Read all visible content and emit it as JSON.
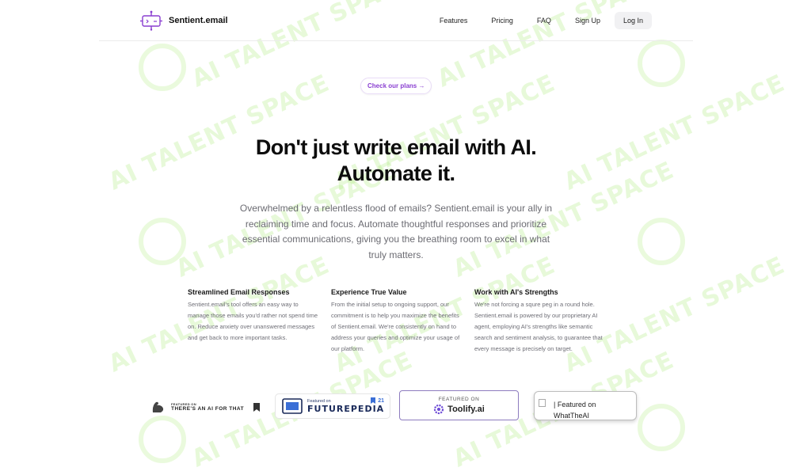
{
  "nav": {
    "brand": "Sentient.email",
    "links": [
      "Features",
      "Pricing",
      "FAQ",
      "Sign Up"
    ],
    "login": "Log In"
  },
  "hero": {
    "pill": "Check our plans →",
    "headline_line1": "Don't just write email with AI.",
    "headline_line2": "Automate it.",
    "subtext": "Overwhelmed by a relentless flood of emails? Sentient.email is your ally in reclaiming time and focus. Automate thoughtful responses and prioritize essential communications, giving you the breathing room to excel in what truly matters."
  },
  "features": [
    {
      "title": "Streamlined Email Responses",
      "body": "Sentient.email's tool offers an easy way to manage those emails you'd rather not spend time on. Reduce anxiety over unanswered messages and get back to more important tasks."
    },
    {
      "title": "Experience True Value",
      "body": "From the initial setup to ongoing support, our commitment is to help you maximize the benefits of Sentient.email. We're consistently on hand to address your queries and optimize your usage of our platform."
    },
    {
      "title": "Work with AI's Strengths",
      "body": "We're not forcing a squre peg in a round hole. Sentient.email is powered by our proprietary AI agent, employing AI's strengths like semantic search and sentiment analysis, to guarantee that every message is precisely on target."
    }
  ],
  "badges": {
    "aift_small": "FEATURED ON",
    "aift_big": "THERE'S AN AI FOR THAT",
    "futurepedia_small": "Featured on",
    "futurepedia_big": "FUTUREPEDIA",
    "futurepedia_count": "21",
    "toolify_small": "FEATURED ON",
    "toolify_big": "Toolify.ai",
    "wta_text": "| Featured on WhatTheAI"
  },
  "watermark": "AI TALENT SPACE",
  "colors": {
    "accent": "#8a3fd1",
    "watermark": "#aaeb78"
  }
}
